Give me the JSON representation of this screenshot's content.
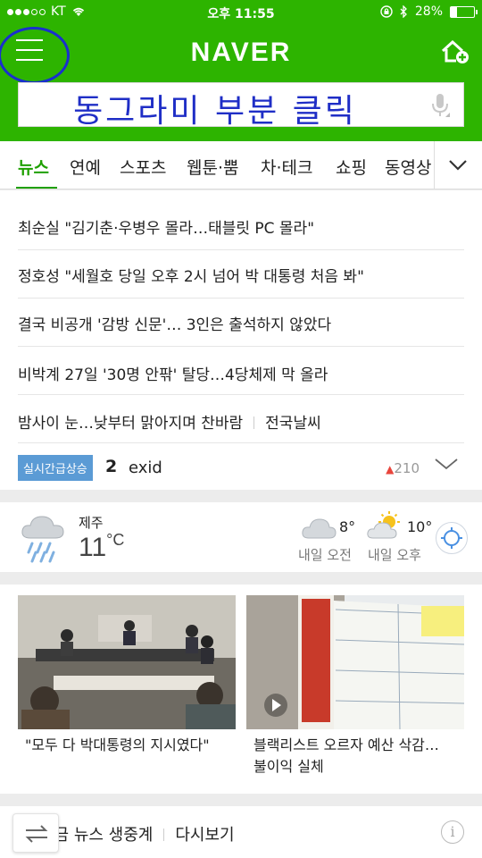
{
  "status_bar": {
    "carrier": "KT",
    "time": "오후 11:55",
    "battery": "28%",
    "battery_level": 0.28
  },
  "header": {
    "logo": "NAVER",
    "menu_icon": "hamburger-menu-icon",
    "home_icon": "home-plus-icon",
    "accent_color": "#2db400",
    "annotation_color": "#1a2fcf"
  },
  "search": {
    "overlay_text": "동그라미 부분 클릭",
    "mic_icon": "microphone-icon"
  },
  "tabs": [
    "뉴스",
    "연예",
    "스포츠",
    "웹툰·뿜",
    "차·테크",
    "쇼핑",
    "동영상"
  ],
  "news": {
    "headlines": [
      "최순실 \"김기춘·우병우 몰라…태블릿 PC 몰라\"",
      "정호성 \"세월호 당일 오후 2시 넘어 박 대통령 처음 봐\"",
      "결국 비공개 '감방 신문'… 3인은 출석하지 않았다",
      "비박계 27일 '30명 안팎' 탈당…4당체제 막 올라"
    ],
    "weather_headline": "밤사이 눈…낮부터 맑아지며 찬바람",
    "weather_link": "전국날씨",
    "realtime": {
      "badge": "실시간급상승",
      "rank": "2",
      "keyword": "exid",
      "count": "210"
    }
  },
  "weather": {
    "city": "제주",
    "temp": "11",
    "unit": "°C",
    "forecasts": [
      {
        "temp": "8°",
        "label": "내일 오전",
        "icon": "cloud-icon"
      },
      {
        "temp": "10°",
        "label": "내일 오후",
        "icon": "sun-cloud-icon"
      }
    ]
  },
  "photo_news": [
    {
      "caption": "\"모두 다 박대통령의 지시였다\""
    },
    {
      "caption_line1": "블랙리스트 오르자 예산 삭감…",
      "caption_line2": "불이익 실체"
    }
  ],
  "bottom": {
    "item1": "지금 뉴스 생중계",
    "item2": "다시보기",
    "info": "i"
  }
}
